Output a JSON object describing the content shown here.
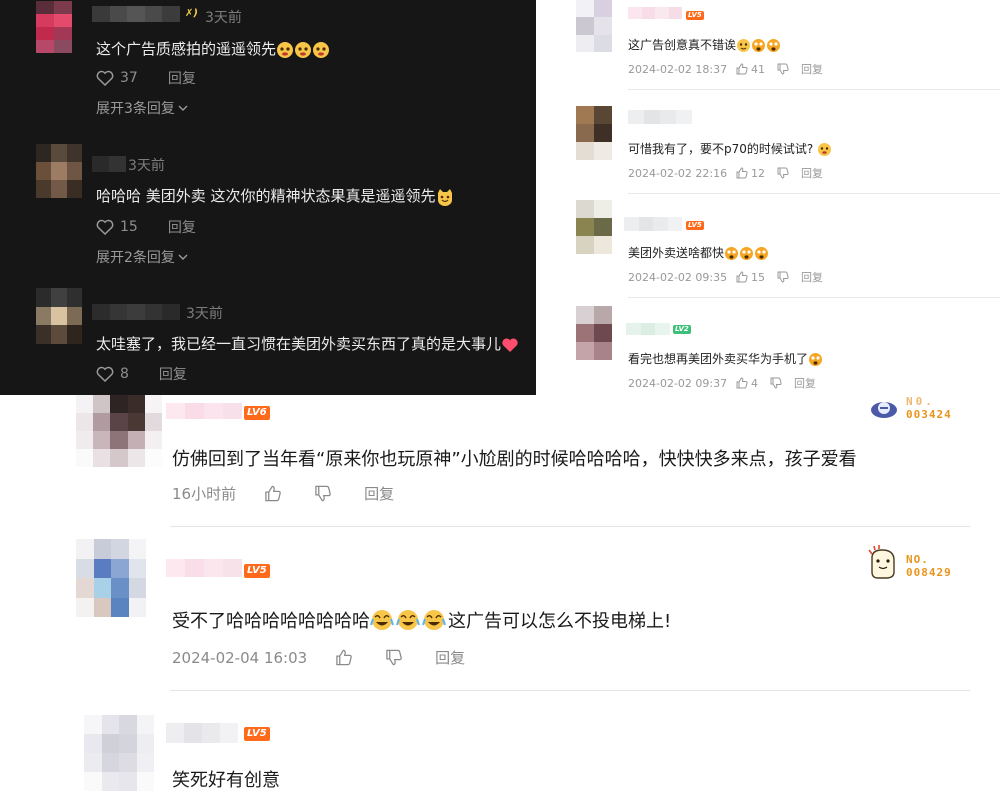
{
  "dark_panel": {
    "comments": [
      {
        "time": "3天前",
        "text": "这个广告质感拍的遥遥领先",
        "likes": "37",
        "reply_label": "回复",
        "expand_label": "展开3条回复"
      },
      {
        "time": "3天前",
        "text": "哈哈哈 美团外卖 这次你的精神状态果真是遥遥领先",
        "likes": "15",
        "reply_label": "回复",
        "expand_label": "展开2条回复"
      },
      {
        "time": "3天前",
        "text": "太哇塞了，我已经一直习惯在美团外卖买东西了真的是大事儿",
        "likes": "8",
        "reply_label": "回复"
      }
    ]
  },
  "right_panel": {
    "comments": [
      {
        "level": "LV5",
        "text": "这广告创意真不错诶",
        "timestamp": "2024-02-02 18:37",
        "likes": "41",
        "reply_label": "回复"
      },
      {
        "text": "可惜我有了，要不p70的时候试试?",
        "timestamp": "2024-02-02 22:16",
        "likes": "12",
        "reply_label": "回复"
      },
      {
        "level": "LV5",
        "text": "美团外卖送啥都快",
        "timestamp": "2024-02-02 09:35",
        "likes": "15",
        "reply_label": "回复"
      },
      {
        "level": "LV2",
        "text": "看完也想再美团外卖买华为手机了",
        "timestamp": "2024-02-02 09:37",
        "likes": "4",
        "reply_label": "回复"
      }
    ]
  },
  "bottom_panel": {
    "comments": [
      {
        "level": "LV6",
        "fan_number": "003424",
        "text": "仿佛回到了当年看“原来你也玩原神”小尬剧的时候哈哈哈哈，快快快多来点，孩子爱看",
        "timestamp": "16小时前",
        "reply_label": "回复"
      },
      {
        "level": "LV5",
        "fan_label": "NO.",
        "fan_number": "008429",
        "text_a": "受不了哈哈哈哈哈哈哈哈",
        "text_b": "这广告可以怎么不投电梯上!",
        "timestamp": "2024-02-04 16:03",
        "reply_label": "回复"
      },
      {
        "level": "LV5",
        "text": "笑死好有创意"
      }
    ]
  },
  "colors": {
    "dark_bg": "#161616",
    "level_orange": "#ff6a1a",
    "level_green": "#3fc07a",
    "heart_pink": "#ff4d6d"
  },
  "icons": [
    "heart-outline-icon",
    "thumb-up-icon",
    "thumb-down-icon",
    "chevron-down-icon",
    "emoji-face-icon",
    "heart-emoji-icon",
    "cat-emoji-icon",
    "laughing-crying-emoji-icon"
  ]
}
